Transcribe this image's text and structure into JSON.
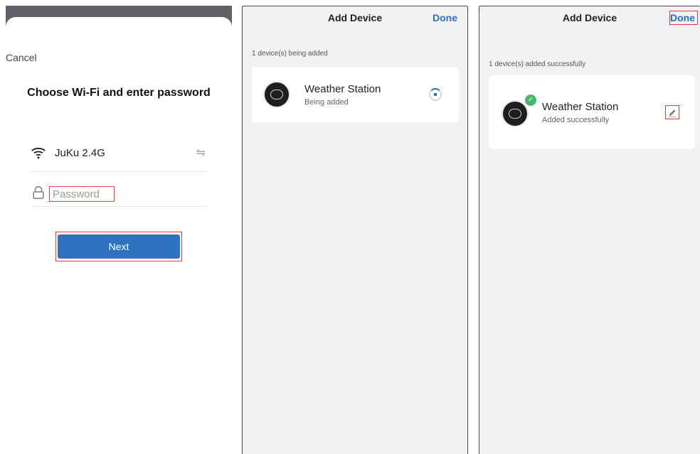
{
  "wifi_screen": {
    "cancel_label": "Cancel",
    "title": "Choose Wi-Fi and enter password",
    "network_name": "JuKu 2.4G",
    "password_placeholder": "Password",
    "next_label": "Next"
  },
  "adding_screen": {
    "title": "Add Device",
    "done_label": "Done",
    "status_text": "1 device(s) being added",
    "device": {
      "name": "Weather Station",
      "status": "Being added"
    }
  },
  "added_screen": {
    "title": "Add Device",
    "done_label": "Done",
    "status_text": "1 device(s) added successfully",
    "device": {
      "name": "Weather Station",
      "status": "Added successfully"
    }
  },
  "icons": {
    "wifi": "wifi-icon",
    "swap": "swap-icon",
    "lock": "lock-icon",
    "spinner": "loading-spinner-icon",
    "check": "check-icon",
    "edit": "edit-icon"
  },
  "colors": {
    "accent": "#2f72c2",
    "highlight": "#e53935",
    "success": "#43b86a"
  }
}
